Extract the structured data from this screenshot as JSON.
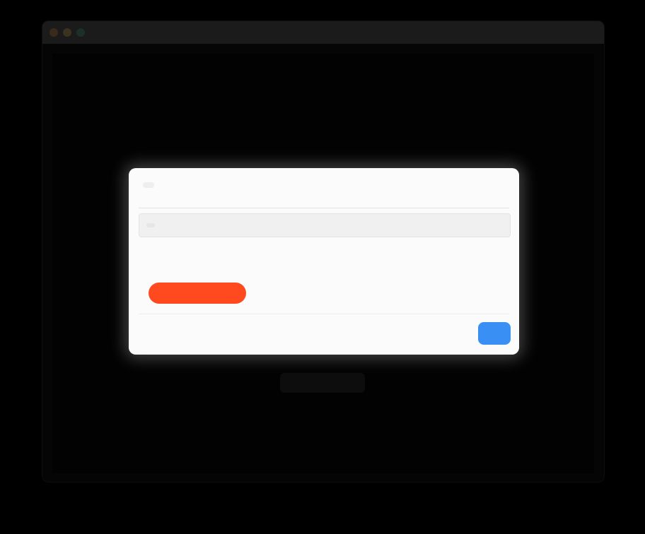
{
  "window": {
    "title": ""
  },
  "backdrop": {
    "button_label": ""
  },
  "dialog": {
    "title": "",
    "field_label": "",
    "field_value": "",
    "caption": "",
    "danger_label": "",
    "cancel_label": "",
    "ok_label": ""
  },
  "colors": {
    "background": "#000000",
    "dialog_bg": "#fbfbfb",
    "danger": "#ff4a1f",
    "primary": "#3a8ff5"
  },
  "icons": {
    "close": "close-window-icon",
    "minimize": "minimize-window-icon",
    "maximize": "maximize-window-icon"
  }
}
